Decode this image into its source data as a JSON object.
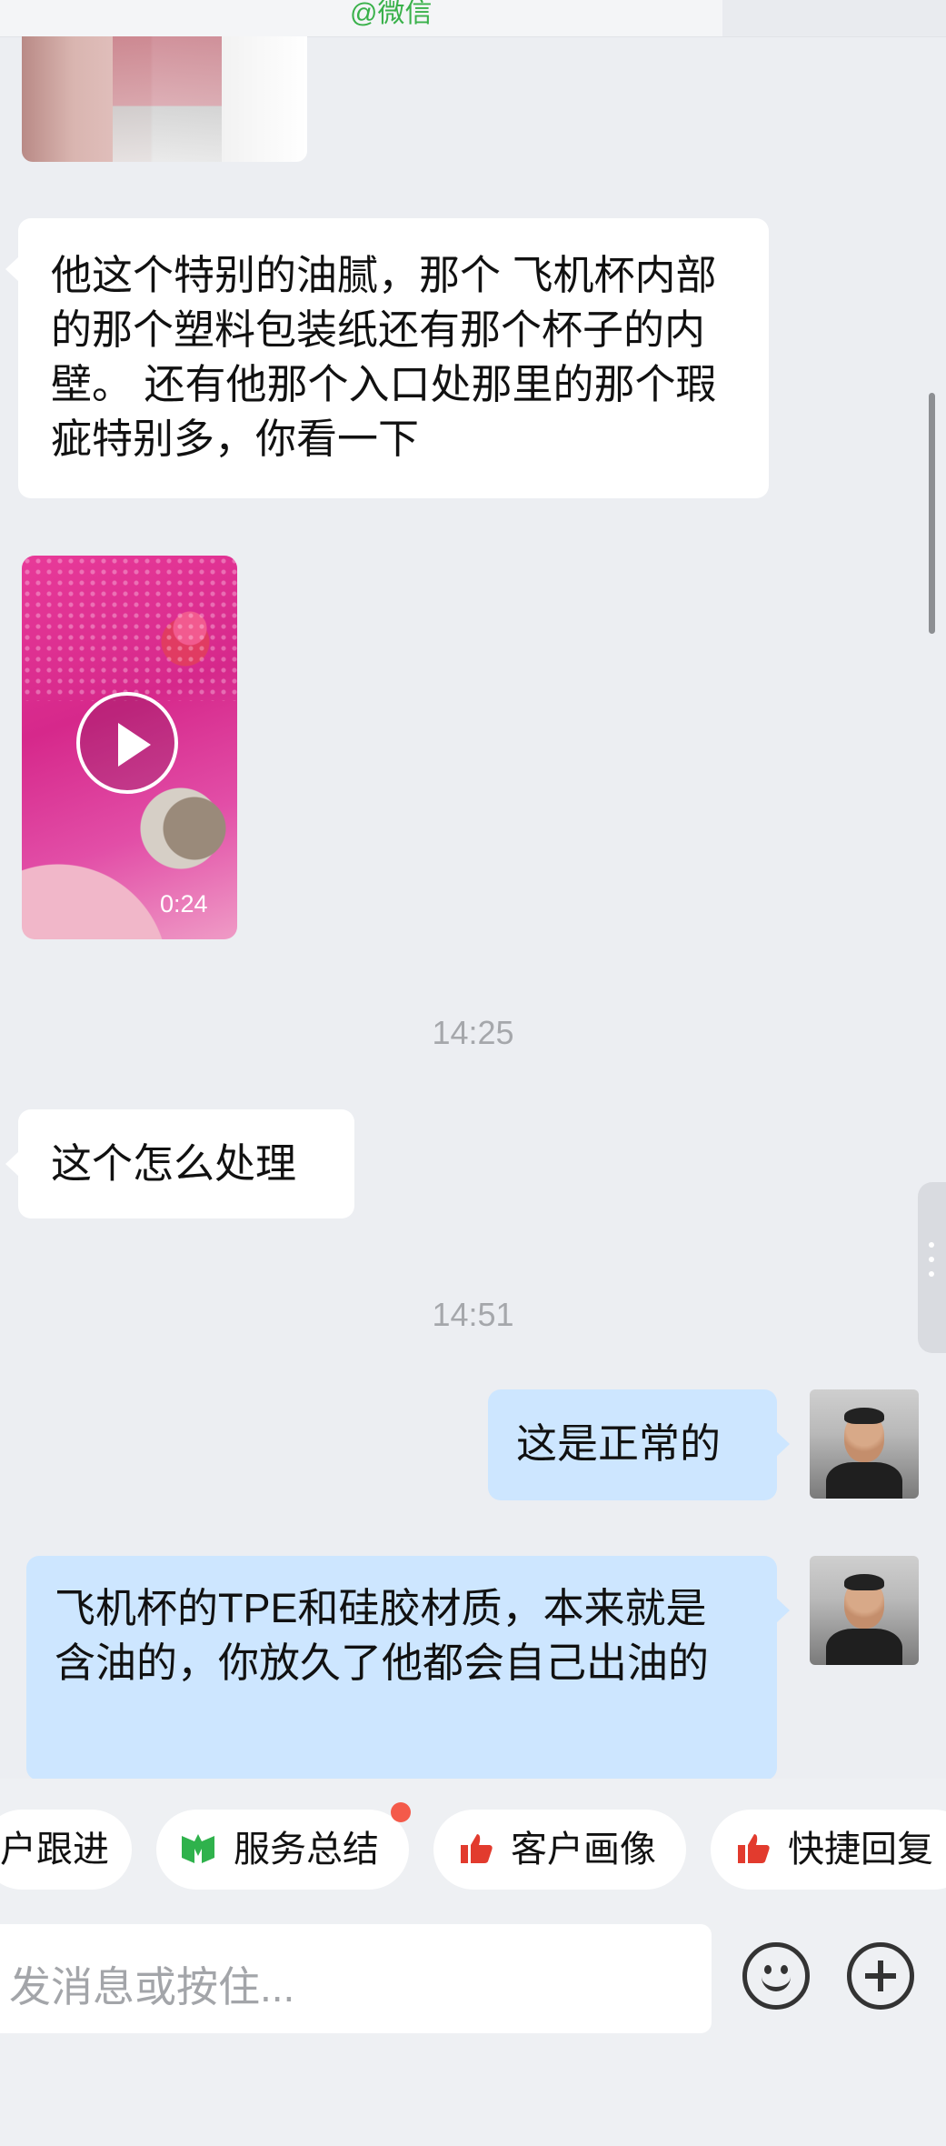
{
  "top_bar": {
    "source": "@微信"
  },
  "messages": [
    {
      "id": "m1",
      "side": "left",
      "text": "他这个特别的油腻，那个 飞机杯内部的那个塑料包装纸还有那个杯子的内壁。 还有他那个入口处那里的那个瑕疵特别多，你看一下"
    },
    {
      "id": "m2",
      "side": "left",
      "type": "video",
      "duration": "0:24"
    },
    {
      "id": "t1",
      "type": "time",
      "text": "14:25"
    },
    {
      "id": "m3",
      "side": "left",
      "text": "这个怎么处理"
    },
    {
      "id": "t2",
      "type": "time",
      "text": "14:51"
    },
    {
      "id": "m4",
      "side": "right",
      "text": "这是正常的"
    },
    {
      "id": "m5",
      "side": "right",
      "text": "飞机杯的TPE和硅胶材质，本来就是含油的，你放久了他都会自己出油的"
    }
  ],
  "quick_actions": [
    {
      "label": "户跟进",
      "icon": ""
    },
    {
      "label": "服务总结",
      "icon": "service-summary-icon",
      "badge": true
    },
    {
      "label": "客户画像",
      "icon": "thumbs-up-icon"
    },
    {
      "label": "快捷回复",
      "icon": "thumbs-up-icon"
    }
  ],
  "input": {
    "placeholder": "发消息或按住..."
  },
  "colors": {
    "bubble_left": "#ffffff",
    "bubble_right": "#cde6ff",
    "background": "#eceef2",
    "accent_red": "#e23b2e",
    "accent_green": "#2fb24c"
  }
}
